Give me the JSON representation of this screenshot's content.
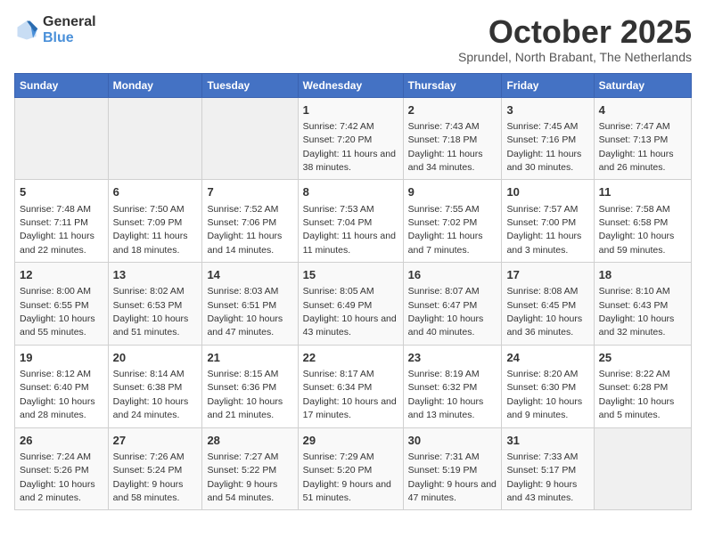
{
  "header": {
    "logo_line1": "General",
    "logo_line2": "Blue",
    "month": "October 2025",
    "location": "Sprundel, North Brabant, The Netherlands"
  },
  "weekdays": [
    "Sunday",
    "Monday",
    "Tuesday",
    "Wednesday",
    "Thursday",
    "Friday",
    "Saturday"
  ],
  "weeks": [
    [
      {
        "day": "",
        "empty": true
      },
      {
        "day": "",
        "empty": true
      },
      {
        "day": "",
        "empty": true
      },
      {
        "day": "1",
        "sunrise": "7:42 AM",
        "sunset": "7:20 PM",
        "daylight": "11 hours and 38 minutes."
      },
      {
        "day": "2",
        "sunrise": "7:43 AM",
        "sunset": "7:18 PM",
        "daylight": "11 hours and 34 minutes."
      },
      {
        "day": "3",
        "sunrise": "7:45 AM",
        "sunset": "7:16 PM",
        "daylight": "11 hours and 30 minutes."
      },
      {
        "day": "4",
        "sunrise": "7:47 AM",
        "sunset": "7:13 PM",
        "daylight": "11 hours and 26 minutes."
      }
    ],
    [
      {
        "day": "5",
        "sunrise": "7:48 AM",
        "sunset": "7:11 PM",
        "daylight": "11 hours and 22 minutes."
      },
      {
        "day": "6",
        "sunrise": "7:50 AM",
        "sunset": "7:09 PM",
        "daylight": "11 hours and 18 minutes."
      },
      {
        "day": "7",
        "sunrise": "7:52 AM",
        "sunset": "7:06 PM",
        "daylight": "11 hours and 14 minutes."
      },
      {
        "day": "8",
        "sunrise": "7:53 AM",
        "sunset": "7:04 PM",
        "daylight": "11 hours and 11 minutes."
      },
      {
        "day": "9",
        "sunrise": "7:55 AM",
        "sunset": "7:02 PM",
        "daylight": "11 hours and 7 minutes."
      },
      {
        "day": "10",
        "sunrise": "7:57 AM",
        "sunset": "7:00 PM",
        "daylight": "11 hours and 3 minutes."
      },
      {
        "day": "11",
        "sunrise": "7:58 AM",
        "sunset": "6:58 PM",
        "daylight": "10 hours and 59 minutes."
      }
    ],
    [
      {
        "day": "12",
        "sunrise": "8:00 AM",
        "sunset": "6:55 PM",
        "daylight": "10 hours and 55 minutes."
      },
      {
        "day": "13",
        "sunrise": "8:02 AM",
        "sunset": "6:53 PM",
        "daylight": "10 hours and 51 minutes."
      },
      {
        "day": "14",
        "sunrise": "8:03 AM",
        "sunset": "6:51 PM",
        "daylight": "10 hours and 47 minutes."
      },
      {
        "day": "15",
        "sunrise": "8:05 AM",
        "sunset": "6:49 PM",
        "daylight": "10 hours and 43 minutes."
      },
      {
        "day": "16",
        "sunrise": "8:07 AM",
        "sunset": "6:47 PM",
        "daylight": "10 hours and 40 minutes."
      },
      {
        "day": "17",
        "sunrise": "8:08 AM",
        "sunset": "6:45 PM",
        "daylight": "10 hours and 36 minutes."
      },
      {
        "day": "18",
        "sunrise": "8:10 AM",
        "sunset": "6:43 PM",
        "daylight": "10 hours and 32 minutes."
      }
    ],
    [
      {
        "day": "19",
        "sunrise": "8:12 AM",
        "sunset": "6:40 PM",
        "daylight": "10 hours and 28 minutes."
      },
      {
        "day": "20",
        "sunrise": "8:14 AM",
        "sunset": "6:38 PM",
        "daylight": "10 hours and 24 minutes."
      },
      {
        "day": "21",
        "sunrise": "8:15 AM",
        "sunset": "6:36 PM",
        "daylight": "10 hours and 21 minutes."
      },
      {
        "day": "22",
        "sunrise": "8:17 AM",
        "sunset": "6:34 PM",
        "daylight": "10 hours and 17 minutes."
      },
      {
        "day": "23",
        "sunrise": "8:19 AM",
        "sunset": "6:32 PM",
        "daylight": "10 hours and 13 minutes."
      },
      {
        "day": "24",
        "sunrise": "8:20 AM",
        "sunset": "6:30 PM",
        "daylight": "10 hours and 9 minutes."
      },
      {
        "day": "25",
        "sunrise": "8:22 AM",
        "sunset": "6:28 PM",
        "daylight": "10 hours and 5 minutes."
      }
    ],
    [
      {
        "day": "26",
        "sunrise": "7:24 AM",
        "sunset": "5:26 PM",
        "daylight": "10 hours and 2 minutes."
      },
      {
        "day": "27",
        "sunrise": "7:26 AM",
        "sunset": "5:24 PM",
        "daylight": "9 hours and 58 minutes."
      },
      {
        "day": "28",
        "sunrise": "7:27 AM",
        "sunset": "5:22 PM",
        "daylight": "9 hours and 54 minutes."
      },
      {
        "day": "29",
        "sunrise": "7:29 AM",
        "sunset": "5:20 PM",
        "daylight": "9 hours and 51 minutes."
      },
      {
        "day": "30",
        "sunrise": "7:31 AM",
        "sunset": "5:19 PM",
        "daylight": "9 hours and 47 minutes."
      },
      {
        "day": "31",
        "sunrise": "7:33 AM",
        "sunset": "5:17 PM",
        "daylight": "9 hours and 43 minutes."
      },
      {
        "day": "",
        "empty": true
      }
    ]
  ]
}
